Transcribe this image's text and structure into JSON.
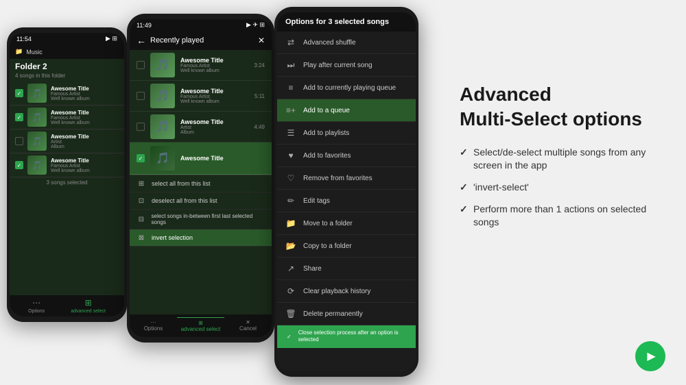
{
  "page": {
    "background": "#f0f0f0"
  },
  "info_panel": {
    "title_line1": "Advanced",
    "title_line2": "Multi-Select options",
    "bullets": [
      "Select/de-select multiple songs from any screen in the app",
      "'invert-select'",
      "Perform more than 1 actions on selected songs"
    ]
  },
  "back_phone": {
    "status_time": "11:54",
    "header_label": "Music",
    "folder_label": "Folder 2",
    "songs_count": "4 songs in this folder",
    "songs": [
      {
        "title": "Awesome Title",
        "artist": "Famous Artist",
        "album": "Well known album",
        "checked": true
      },
      {
        "title": "Awesome Title",
        "artist": "Famous Artist",
        "album": "Well known album",
        "checked": true
      },
      {
        "title": "Awesome Title",
        "artist": "Artist",
        "album": "Album",
        "checked": false
      },
      {
        "title": "Awesome Title",
        "artist": "Famous Artist",
        "album": "Well known album",
        "checked": true
      }
    ],
    "selected_count": "3 songs selected",
    "bottom_tabs": [
      "Options",
      "advanced select"
    ]
  },
  "mid_phone": {
    "status_time": "11:49",
    "header_label": "Recently played",
    "songs": [
      {
        "title": "Awesome Title",
        "artist": "Famous Artist",
        "album": "Well known album",
        "duration": "3:24"
      },
      {
        "title": "Awesome Title",
        "artist": "Famous Artist",
        "album": "Well known album",
        "duration": "5:11"
      },
      {
        "title": "Awesome Title",
        "artist": "Artist",
        "album": "Album",
        "duration": "4:49"
      }
    ],
    "selected_song": "Awesome Title",
    "menu_items": [
      "select all from this list",
      "deselect all from this list",
      "select songs in-between first last selected songs",
      "invert selection"
    ],
    "bottom_tabs": [
      "Options",
      "advanced select",
      "Cancel"
    ]
  },
  "front_phone": {
    "menu_title": "Options for 3 selected songs",
    "menu_items": [
      {
        "icon": "shuffle",
        "label": "Advanced shuffle"
      },
      {
        "icon": "play-next",
        "label": "Play after current song"
      },
      {
        "icon": "queue",
        "label": "Add to currently playing queue"
      },
      {
        "icon": "queue-add",
        "label": "Add to a queue",
        "active": true
      },
      {
        "icon": "playlist",
        "label": "Add to playlists"
      },
      {
        "icon": "heart",
        "label": "Add to favorites"
      },
      {
        "icon": "heart-empty",
        "label": "Remove from favorites"
      },
      {
        "icon": "tag",
        "label": "Edit tags"
      },
      {
        "icon": "folder-move",
        "label": "Move to a folder"
      },
      {
        "icon": "folder-copy",
        "label": "Copy to a folder"
      },
      {
        "icon": "share",
        "label": "Share"
      },
      {
        "icon": "history",
        "label": "Clear playback history"
      },
      {
        "icon": "trash",
        "label": "Delete permanently"
      }
    ],
    "checkbox_label": "Close selection process after an option is selected"
  }
}
